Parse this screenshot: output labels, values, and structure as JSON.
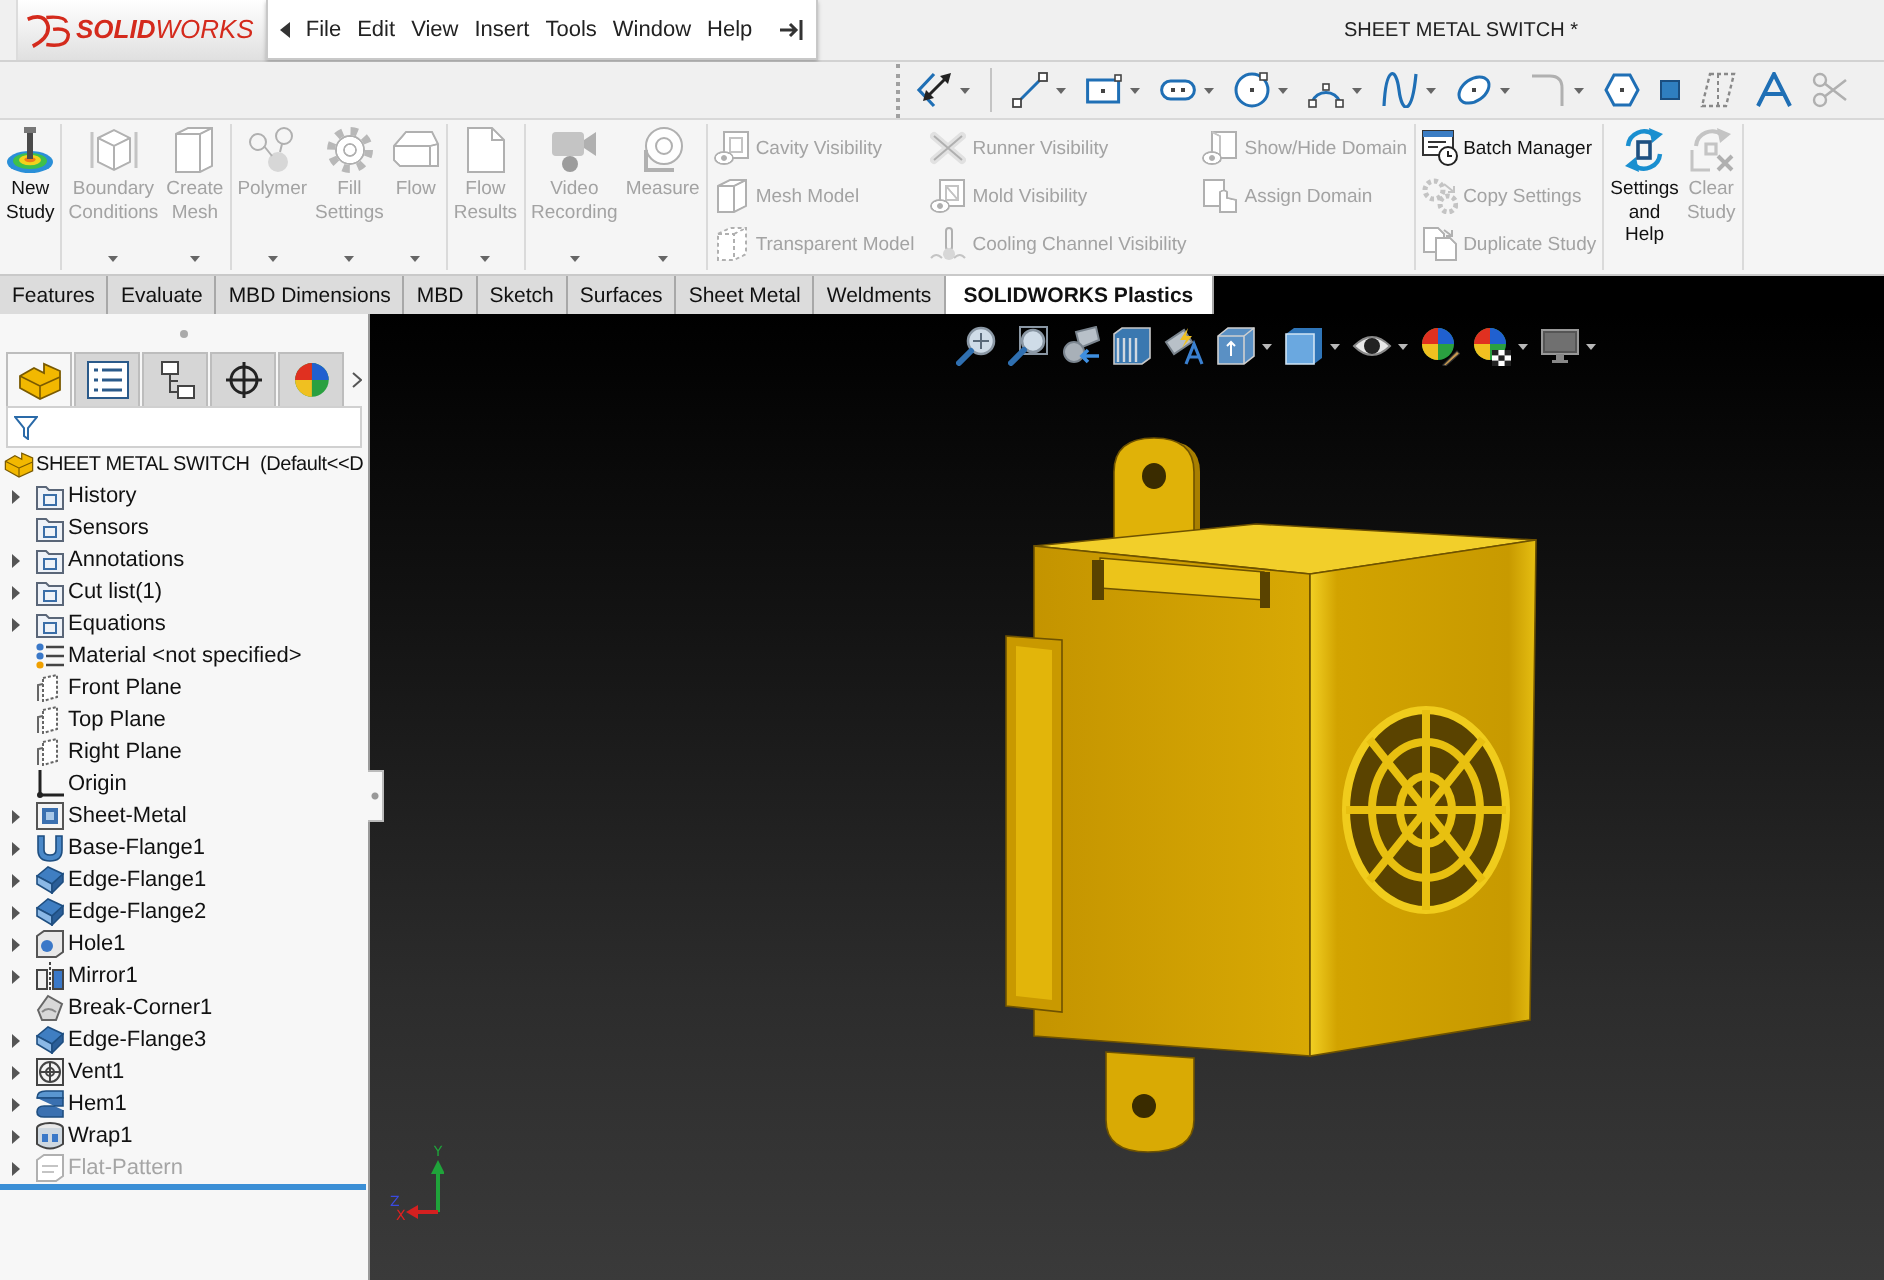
{
  "title_bar": {
    "logo": "**SOLID**WORKS",
    "menu": [
      "File",
      "Edit",
      "View",
      "Insert",
      "Tools",
      "Window",
      "Help"
    ],
    "title": "SHEET METAL SWITCH *"
  },
  "sketch_toolbar": [
    {
      "dropdown": true,
      "disabled": false
    },
    {
      "dropdown": true,
      "disabled": false
    },
    {
      "dropdown": true,
      "disabled": false
    },
    {
      "dropdown": true,
      "disabled": false
    },
    {
      "dropdown": true,
      "disabled": false
    },
    {
      "dropdown": true,
      "disabled": false
    },
    {
      "dropdown": true,
      "disabled": false
    },
    {
      "dropdown": true,
      "disabled": false
    },
    {
      "dropdown": true,
      "disabled": true
    },
    {
      "dropdown": false,
      "disabled": false
    },
    {
      "dropdown": false,
      "disabled": false
    },
    {
      "dropdown": false,
      "disabled": true
    },
    {
      "dropdown": false,
      "disabled": false
    },
    {
      "dropdown": false,
      "disabled": true
    }
  ],
  "ribbon": {
    "groups": [
      {
        "items": [
          {
            "kind": "large",
            "label": "New Study",
            "disabled": false,
            "dropdown": false
          }
        ]
      },
      {
        "items": [
          {
            "kind": "large",
            "label": "Boundary Conditions",
            "disabled": true,
            "dropdown": true
          },
          {
            "kind": "large",
            "label": "Create Mesh",
            "disabled": true,
            "dropdown": true
          }
        ]
      },
      {
        "items": [
          {
            "kind": "large",
            "label": "Polymer",
            "disabled": true,
            "dropdown": true
          },
          {
            "kind": "large",
            "label": "Fill Settings",
            "disabled": true,
            "dropdown": true
          },
          {
            "kind": "large",
            "label": "Flow",
            "disabled": true,
            "dropdown": true
          }
        ]
      },
      {
        "items": [
          {
            "kind": "large",
            "label": "Flow Results",
            "disabled": true,
            "dropdown": true
          }
        ]
      },
      {
        "items": [
          {
            "kind": "large",
            "label": "Video Recording",
            "disabled": true,
            "dropdown": true
          },
          {
            "kind": "large",
            "label": "Measure",
            "disabled": true,
            "dropdown": true
          }
        ]
      },
      {
        "items": [
          {
            "kind": "small",
            "label": "Cavity Visibility",
            "disabled": true
          },
          {
            "kind": "small",
            "label": "Mesh Model",
            "disabled": true
          },
          {
            "kind": "small",
            "label": "Transparent Model",
            "disabled": true
          },
          {
            "kind": "small",
            "label": "Runner Visibility",
            "disabled": true
          },
          {
            "kind": "small",
            "label": "Mold Visibility",
            "disabled": true
          },
          {
            "kind": "small",
            "label": "Cooling Channel Visibility",
            "disabled": true
          },
          {
            "kind": "small",
            "label": "Show/Hide Domain",
            "disabled": true
          },
          {
            "kind": "small",
            "label": "Assign Domain",
            "disabled": true
          }
        ]
      },
      {
        "items": [
          {
            "kind": "small",
            "label": "Batch Manager",
            "disabled": false
          },
          {
            "kind": "small",
            "label": "Copy Settings",
            "disabled": true
          },
          {
            "kind": "small",
            "label": "Duplicate Study",
            "disabled": true
          }
        ]
      },
      {
        "items": [
          {
            "kind": "large",
            "label": "Settings and Help",
            "disabled": false,
            "dropdown": false
          },
          {
            "kind": "large",
            "label": "Clear Study",
            "disabled": true,
            "dropdown": false
          }
        ]
      }
    ]
  },
  "tabs": [
    {
      "label": "Features",
      "selected": false
    },
    {
      "label": "Evaluate",
      "selected": false
    },
    {
      "label": "MBD Dimensions",
      "selected": false
    },
    {
      "label": "MBD",
      "selected": false
    },
    {
      "label": "Sketch",
      "selected": false
    },
    {
      "label": "Surfaces",
      "selected": false
    },
    {
      "label": "Sheet Metal",
      "selected": false
    },
    {
      "label": "Weldments",
      "selected": false
    },
    {
      "label": "SOLIDWORKS Plastics",
      "selected": true
    }
  ],
  "feature_panel": {
    "tabs": [
      {
        "selected": true
      },
      {
        "selected": false
      },
      {
        "selected": false
      },
      {
        "selected": false
      },
      {
        "selected": false
      }
    ],
    "tree": {
      "label": "SHEET METAL SWITCH  (Default<<D",
      "children": [
        {
          "label": "History",
          "expandable": true,
          "expanded": false,
          "disabled": false
        },
        {
          "label": "Sensors",
          "expandable": false,
          "expanded": false,
          "disabled": false
        },
        {
          "label": "Annotations",
          "expandable": true,
          "expanded": false,
          "disabled": false
        },
        {
          "label": "Cut list(1)",
          "expandable": true,
          "expanded": false,
          "disabled": false
        },
        {
          "label": "Equations",
          "expandable": true,
          "expanded": false,
          "disabled": false
        },
        {
          "label": "Material <not specified>",
          "expandable": false,
          "expanded": false,
          "disabled": false
        },
        {
          "label": "Front Plane",
          "expandable": false,
          "expanded": false,
          "disabled": false
        },
        {
          "label": "Top Plane",
          "expandable": false,
          "expanded": false,
          "disabled": false
        },
        {
          "label": "Right Plane",
          "expandable": false,
          "expanded": false,
          "disabled": false
        },
        {
          "label": "Origin",
          "expandable": false,
          "expanded": false,
          "disabled": false
        },
        {
          "label": "Sheet-Metal",
          "expandable": true,
          "expanded": false,
          "disabled": false
        },
        {
          "label": "Base-Flange1",
          "expandable": true,
          "expanded": false,
          "disabled": false
        },
        {
          "label": "Edge-Flange1",
          "expandable": true,
          "expanded": false,
          "disabled": false
        },
        {
          "label": "Edge-Flange2",
          "expandable": true,
          "expanded": false,
          "disabled": false
        },
        {
          "label": "Hole1",
          "expandable": true,
          "expanded": false,
          "disabled": false
        },
        {
          "label": "Mirror1",
          "expandable": true,
          "expanded": false,
          "disabled": false
        },
        {
          "label": "Break-Corner1",
          "expandable": false,
          "expanded": false,
          "disabled": false
        },
        {
          "label": "Edge-Flange3",
          "expandable": true,
          "expanded": false,
          "disabled": false
        },
        {
          "label": "Vent1",
          "expandable": true,
          "expanded": false,
          "disabled": false
        },
        {
          "label": "Hem1",
          "expandable": true,
          "expanded": false,
          "disabled": false
        },
        {
          "label": "Wrap1",
          "expandable": true,
          "expanded": false,
          "disabled": false
        },
        {
          "label": "Flat-Pattern",
          "expandable": true,
          "expanded": false,
          "disabled": true
        }
      ]
    }
  },
  "viewport": {
    "toolbar": [
      {
        "dropdown": false
      },
      {
        "dropdown": false
      },
      {
        "dropdown": false
      },
      {
        "dropdown": false
      },
      {
        "dropdown": false
      },
      {
        "dropdown": true
      },
      {
        "dropdown": true
      },
      {
        "dropdown": true
      },
      {
        "dropdown": false
      },
      {
        "dropdown": true
      },
      {
        "dropdown": true
      }
    ],
    "triad": [
      "Y",
      "Z",
      "X"
    ]
  }
}
